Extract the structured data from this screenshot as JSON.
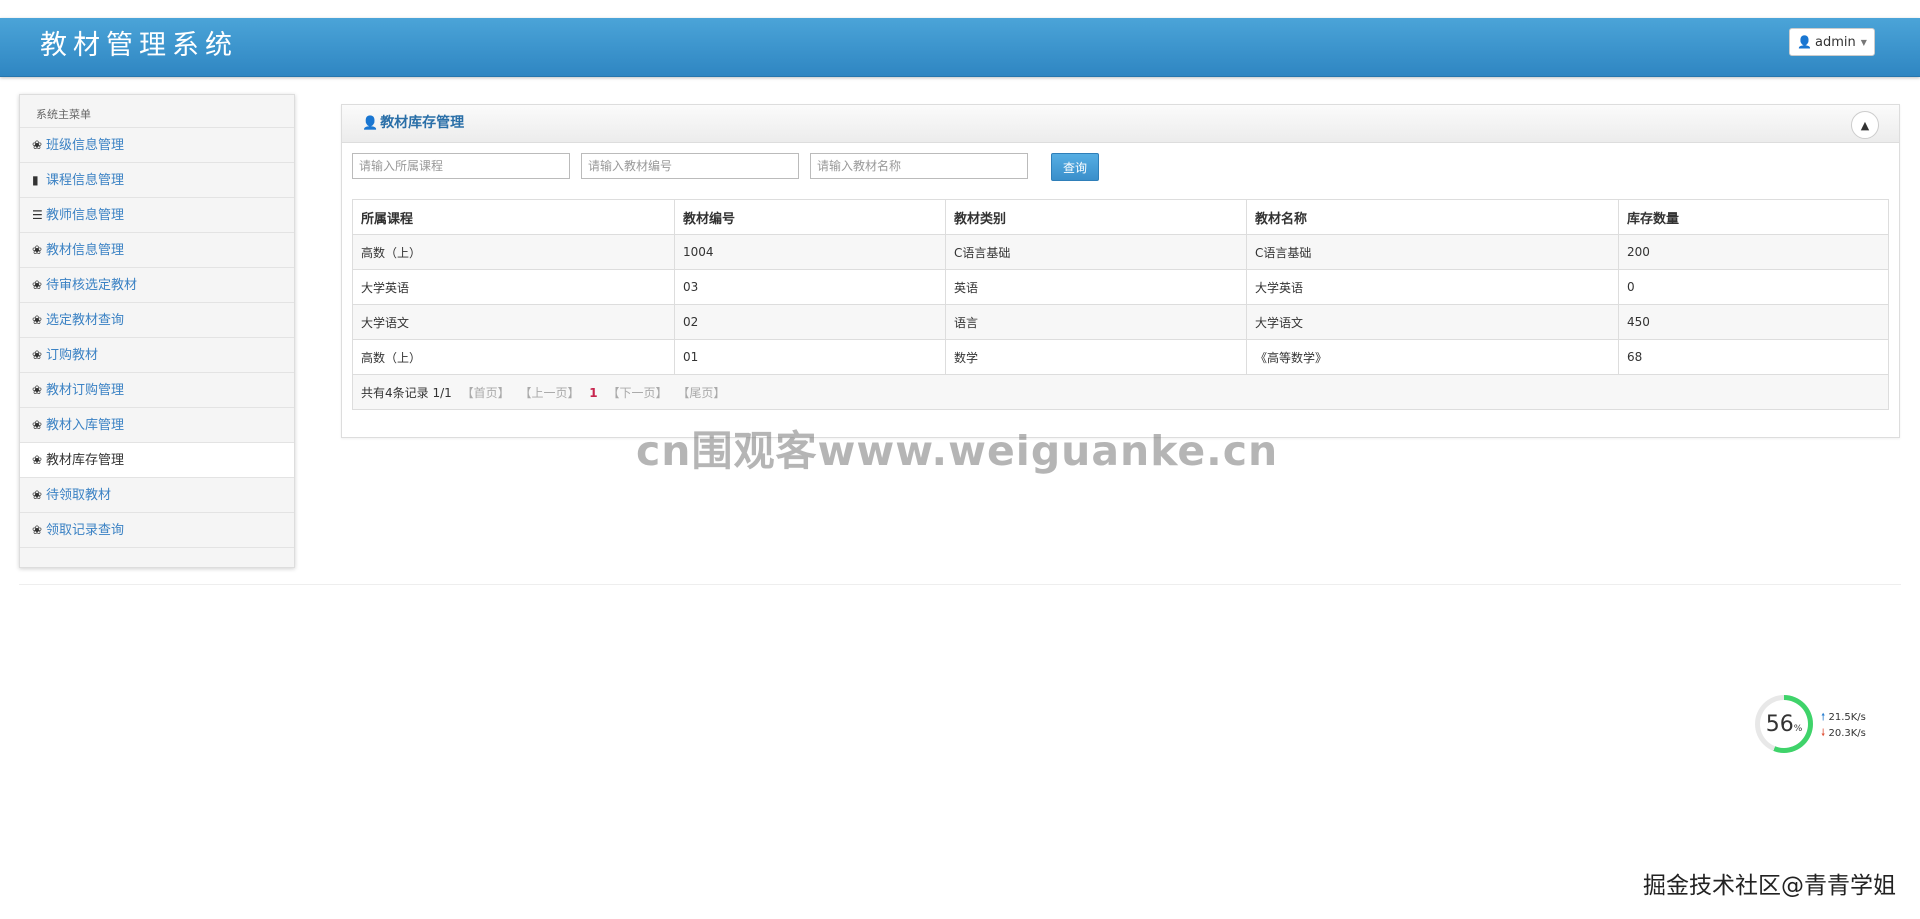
{
  "app": {
    "title": "教材管理系统"
  },
  "user_menu": {
    "label": "admin"
  },
  "sidebar": {
    "title": "系统主菜单",
    "items": [
      {
        "label": "班级信息管理",
        "icon": "leaf-icon"
      },
      {
        "label": "课程信息管理",
        "icon": "bookmark-icon"
      },
      {
        "label": "教师信息管理",
        "icon": "list-icon"
      },
      {
        "label": "教材信息管理",
        "icon": "leaf-icon"
      },
      {
        "label": "待审核选定教材",
        "icon": "leaf-icon"
      },
      {
        "label": "选定教材查询",
        "icon": "leaf-icon"
      },
      {
        "label": "订购教材",
        "icon": "leaf-icon"
      },
      {
        "label": "教材订购管理",
        "icon": "leaf-icon"
      },
      {
        "label": "教材入库管理",
        "icon": "leaf-icon"
      },
      {
        "label": "教材库存管理",
        "icon": "leaf-icon",
        "active": true
      },
      {
        "label": "待领取教材",
        "icon": "leaf-icon"
      },
      {
        "label": "领取记录查询",
        "icon": "leaf-icon"
      }
    ]
  },
  "panel": {
    "title": "教材库存管理",
    "search": {
      "course_placeholder": "请输入所属课程",
      "code_placeholder": "请输入教材编号",
      "name_placeholder": "请输入教材名称",
      "button_label": "查询"
    },
    "table": {
      "columns": [
        "所属课程",
        "教材编号",
        "教材类别",
        "教材名称",
        "库存数量"
      ],
      "rows": [
        [
          "高数（上）",
          "1004",
          "C语言基础",
          "C语言基础",
          "200"
        ],
        [
          "大学英语",
          "03",
          "英语",
          "大学英语",
          "0"
        ],
        [
          "大学语文",
          "02",
          "语言",
          "大学语文",
          "450"
        ],
        [
          "高数（上）",
          "01",
          "数学",
          "《高等数学》",
          "68"
        ]
      ]
    },
    "pager": {
      "summary": "共有4条记录 1/1",
      "first": "【首页】",
      "prev": "【上一页】",
      "current": "1",
      "next": "【下一页】",
      "last": "【尾页】"
    }
  },
  "overlay": {
    "watermark_center": "cn围观客www.weiguanke.cn",
    "watermark_bottom": "掘金技术社区@青青学姐",
    "speed": {
      "percent": "56",
      "percent_unit": "%",
      "upload": "21.5K/s",
      "download": "20.3K/s"
    }
  }
}
